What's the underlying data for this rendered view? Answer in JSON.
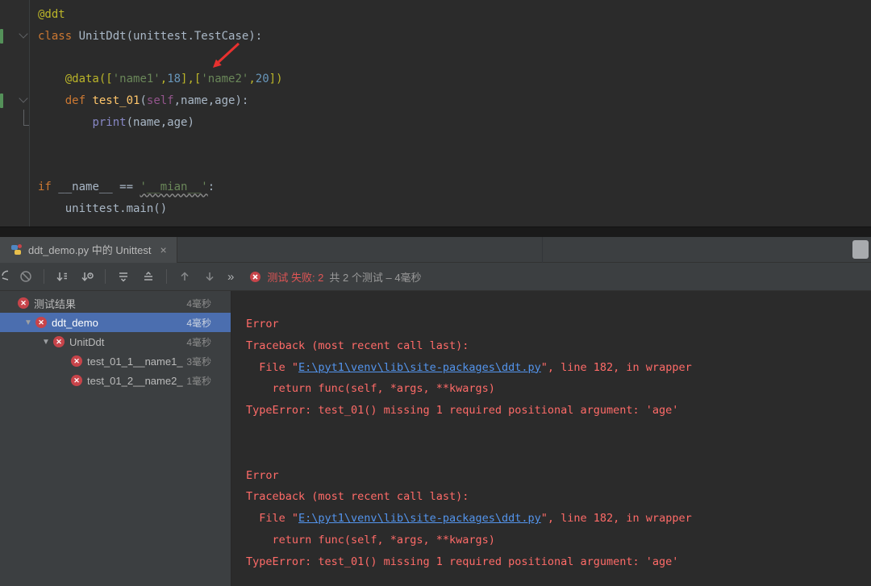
{
  "colors": {
    "selection_blue": "#4b6eaf",
    "error_red": "#ff6b68",
    "link_blue": "#5394ec",
    "status_fail_red": "#e05555",
    "vcs_change_green": "#549159",
    "annotation_arrow_red": "#e8312f"
  },
  "editor": {
    "lines": [
      [
        {
          "t": "@ddt",
          "c": "deco"
        }
      ],
      [
        {
          "t": "class",
          "c": "kw"
        },
        {
          "t": " UnitDdt(unittest.TestCase):",
          "c": "plain"
        }
      ],
      [],
      [
        {
          "t": "    ",
          "c": "plain"
        },
        {
          "t": "@data([",
          "c": "deco"
        },
        {
          "t": "'name1'",
          "c": "str"
        },
        {
          "t": ",",
          "c": "deco"
        },
        {
          "t": "18",
          "c": "num"
        },
        {
          "t": "],[",
          "c": "deco"
        },
        {
          "t": "'name2'",
          "c": "str"
        },
        {
          "t": ",",
          "c": "deco"
        },
        {
          "t": "20",
          "c": "num"
        },
        {
          "t": "])",
          "c": "deco"
        }
      ],
      [
        {
          "t": "    ",
          "c": "plain"
        },
        {
          "t": "def ",
          "c": "kw"
        },
        {
          "t": "test_01",
          "c": "fn"
        },
        {
          "t": "(",
          "c": "plain"
        },
        {
          "t": "self",
          "c": "self"
        },
        {
          "t": ",name,age):",
          "c": "plain"
        }
      ],
      [
        {
          "t": "        ",
          "c": "plain"
        },
        {
          "t": "print",
          "c": "builtin"
        },
        {
          "t": "(name,age)",
          "c": "plain"
        }
      ],
      [],
      [],
      [
        {
          "t": "if ",
          "c": "kw"
        },
        {
          "t": "__name__ == ",
          "c": "plain"
        },
        {
          "t": "'__mian__'",
          "c": "strund"
        },
        {
          "t": ":",
          "c": "plain"
        }
      ],
      [
        {
          "t": "    unittest.main()",
          "c": "plain"
        }
      ]
    ]
  },
  "tool_window": {
    "tab": {
      "icon": "unittest-run-config-icon",
      "title": "ddt_demo.py 中的 Unittest",
      "close": "×"
    },
    "toolbar": {
      "icons": [
        "rerun",
        "stop",
        "sort-alphabetically",
        "sort-by-duration",
        "expand-all",
        "collapse-all",
        "previous-failed-test",
        "next-failed-test",
        "more"
      ],
      "more_label": "»",
      "status": {
        "icon": "failed-test",
        "fail_text": "测试 失败: 2",
        "summary_text": "共 2 个测试 – 4毫秒"
      }
    },
    "tree": {
      "items": [
        {
          "label": "测试结果",
          "time": "4毫秒",
          "depth": 0,
          "chevron": false,
          "selected": false
        },
        {
          "label": "ddt_demo",
          "time": "4毫秒",
          "depth": 1,
          "chevron": true,
          "selected": true
        },
        {
          "label": "UnitDdt",
          "time": "4毫秒",
          "depth": 2,
          "chevron": true,
          "selected": false
        },
        {
          "label": "test_01_1__name1_",
          "time": "3毫秒",
          "depth": 3,
          "chevron": false,
          "selected": false
        },
        {
          "label": "test_01_2__name2_",
          "time": "1毫秒",
          "depth": 3,
          "chevron": false,
          "selected": false
        }
      ]
    },
    "console": {
      "lines": [
        [
          {
            "t": "Error",
            "c": "red"
          }
        ],
        [
          {
            "t": "Traceback (most recent call last):",
            "c": "red"
          }
        ],
        [
          {
            "t": "  File \"",
            "c": "red"
          },
          {
            "t": "E:\\pyt1\\venv\\lib\\site-packages\\ddt.py",
            "c": "link"
          },
          {
            "t": "\", line 182, in wrapper",
            "c": "red"
          }
        ],
        [
          {
            "t": "    return func(self, *args, **kwargs)",
            "c": "red"
          }
        ],
        [
          {
            "t": "TypeError: test_01() missing 1 required positional argument: 'age'",
            "c": "red"
          }
        ],
        [],
        [],
        [
          {
            "t": "Error",
            "c": "red"
          }
        ],
        [
          {
            "t": "Traceback (most recent call last):",
            "c": "red"
          }
        ],
        [
          {
            "t": "  File \"",
            "c": "red"
          },
          {
            "t": "E:\\pyt1\\venv\\lib\\site-packages\\ddt.py",
            "c": "link"
          },
          {
            "t": "\", line 182, in wrapper",
            "c": "red"
          }
        ],
        [
          {
            "t": "    return func(self, *args, **kwargs)",
            "c": "red"
          }
        ],
        [
          {
            "t": "TypeError: test_01() missing 1 required positional argument: 'age'",
            "c": "red"
          }
        ]
      ]
    }
  }
}
